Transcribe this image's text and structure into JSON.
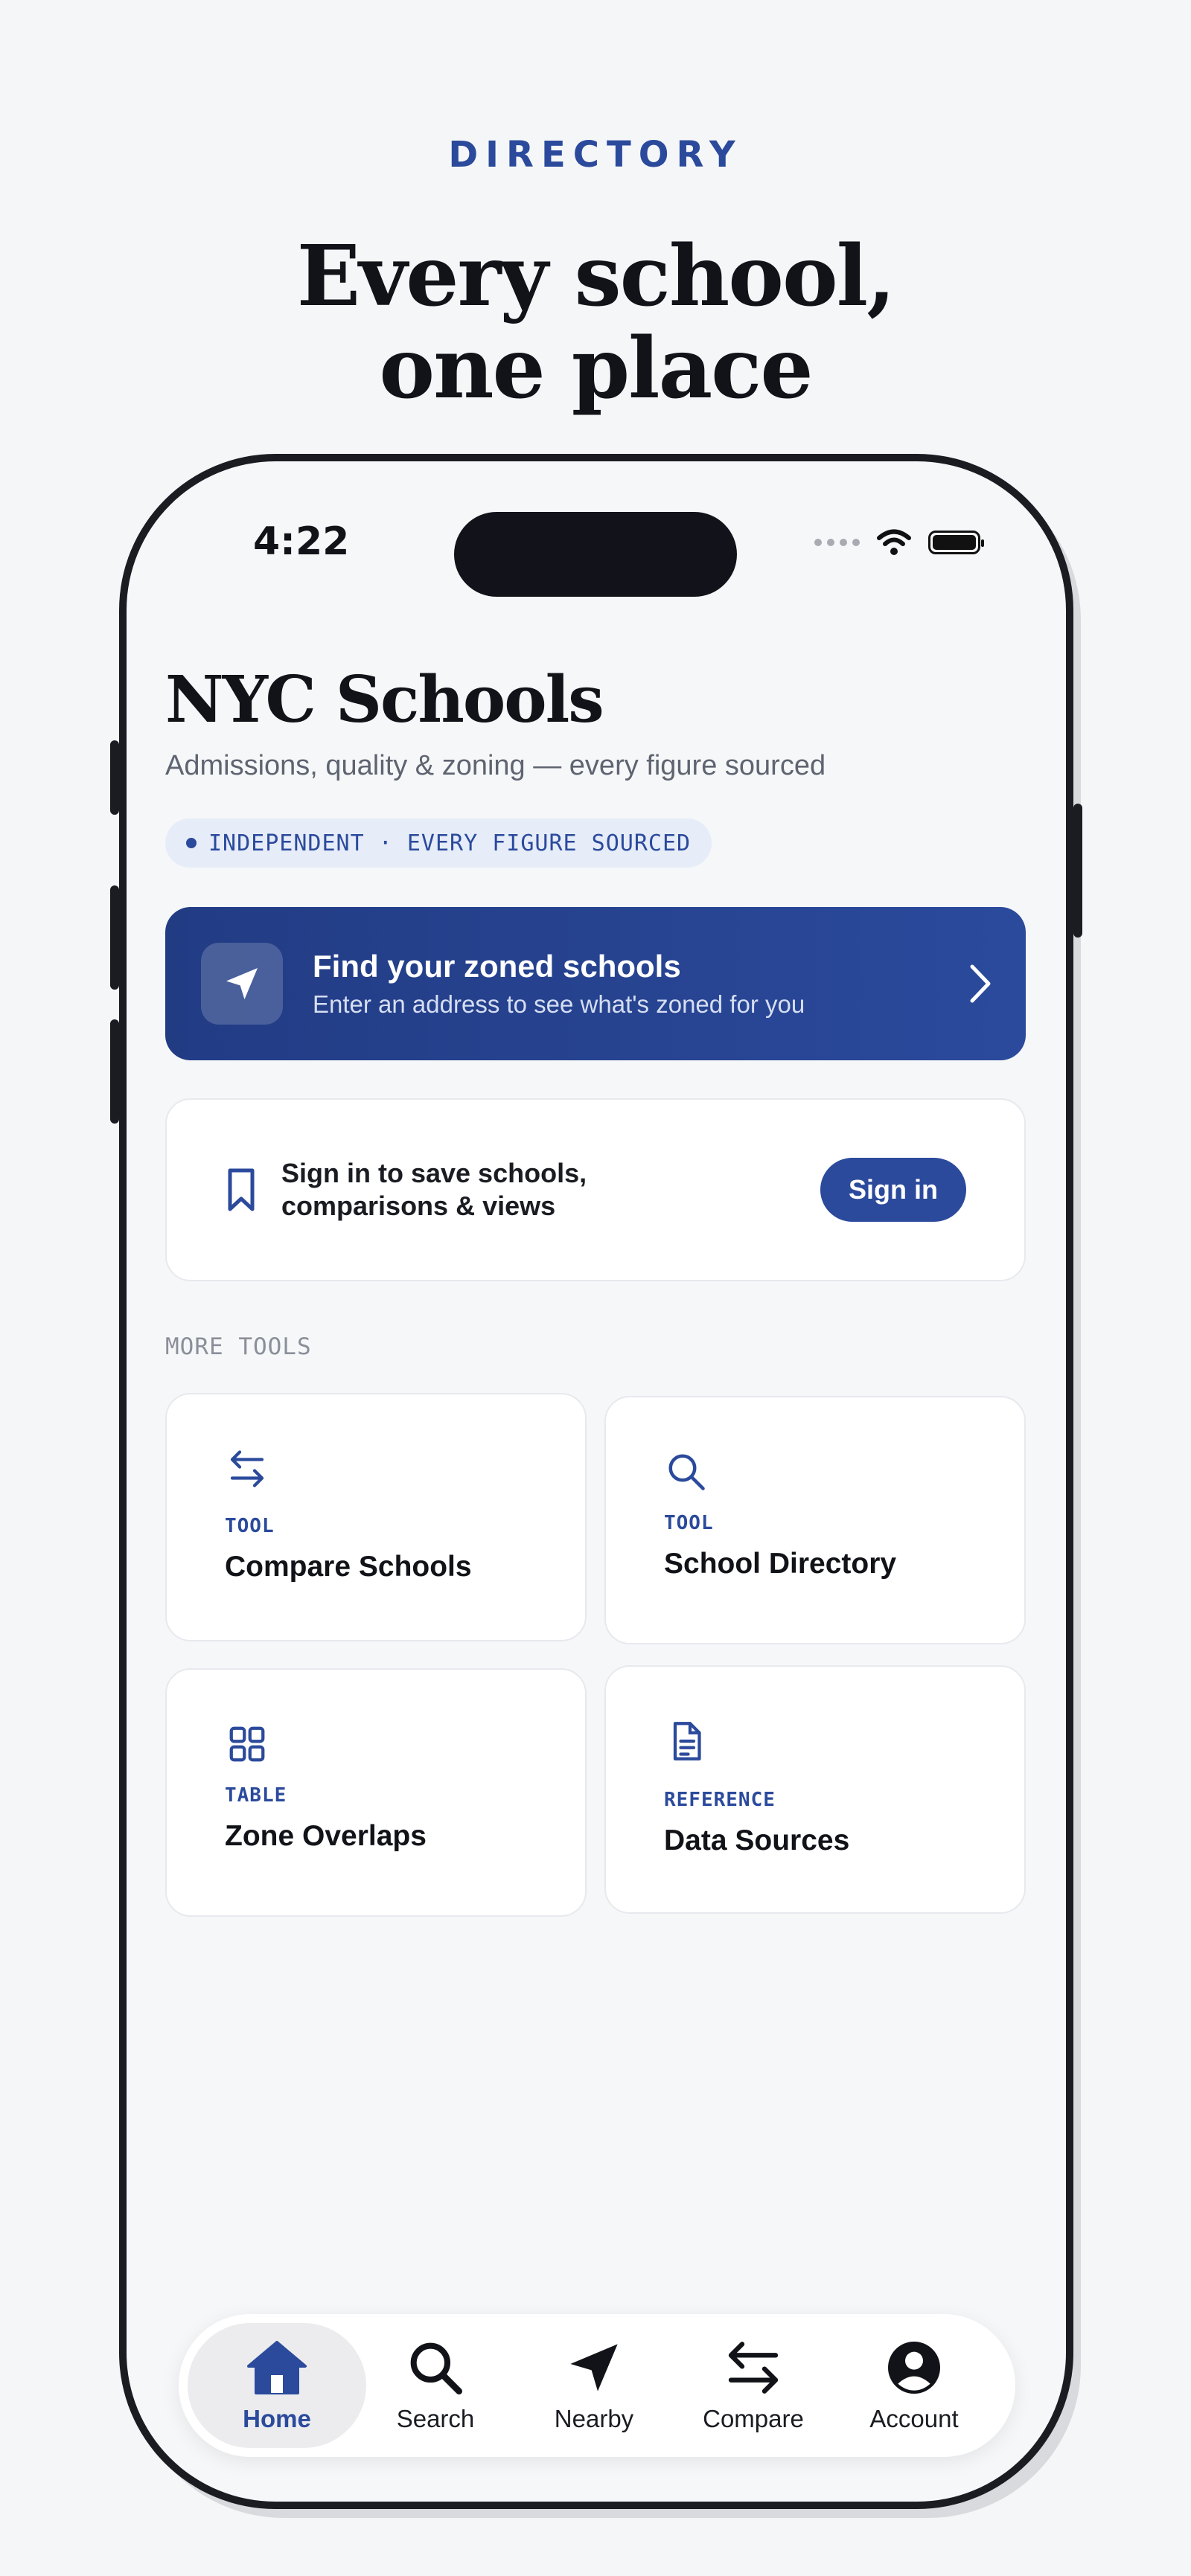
{
  "header": {
    "eyebrow": "DIRECTORY",
    "headline_line1": "Every school,",
    "headline_line2": "one place"
  },
  "status_bar": {
    "time": "4:22",
    "icons": [
      "signal-dots-icon",
      "wifi-icon",
      "battery-icon"
    ]
  },
  "app": {
    "title": "NYC Schools",
    "subtitle": "Admissions, quality & zoning — every figure sourced",
    "badge": "INDEPENDENT · EVERY FIGURE SOURCED"
  },
  "cta": {
    "title": "Find your zoned schools",
    "subtitle": "Enter an address to see what's zoned for you",
    "icon": "navigation-arrow-icon"
  },
  "signin": {
    "line1": "Sign in to save schools,",
    "line2": "comparisons & views",
    "button": "Sign in",
    "icon": "bookmark-icon"
  },
  "more_tools": {
    "label": "MORE TOOLS",
    "items": [
      {
        "kind": "TOOL",
        "name": "Compare Schools",
        "icon": "compare-arrows-icon"
      },
      {
        "kind": "TOOL",
        "name": "School Directory",
        "icon": "search-icon"
      },
      {
        "kind": "TABLE",
        "name": "Zone Overlaps",
        "icon": "grid-icon"
      },
      {
        "kind": "REFERENCE",
        "name": "Data Sources",
        "icon": "document-icon"
      }
    ]
  },
  "tabbar": {
    "active": "Home",
    "items": [
      {
        "label": "Home",
        "icon": "home-icon"
      },
      {
        "label": "Search",
        "icon": "search-icon"
      },
      {
        "label": "Nearby",
        "icon": "navigation-arrow-icon"
      },
      {
        "label": "Compare",
        "icon": "compare-arrows-icon"
      },
      {
        "label": "Account",
        "icon": "account-icon"
      }
    ]
  },
  "colors": {
    "accent": "#2b4a9c",
    "cta_gradient_start": "#223c84",
    "background": "#f4f6f8",
    "text_primary": "#111318"
  }
}
